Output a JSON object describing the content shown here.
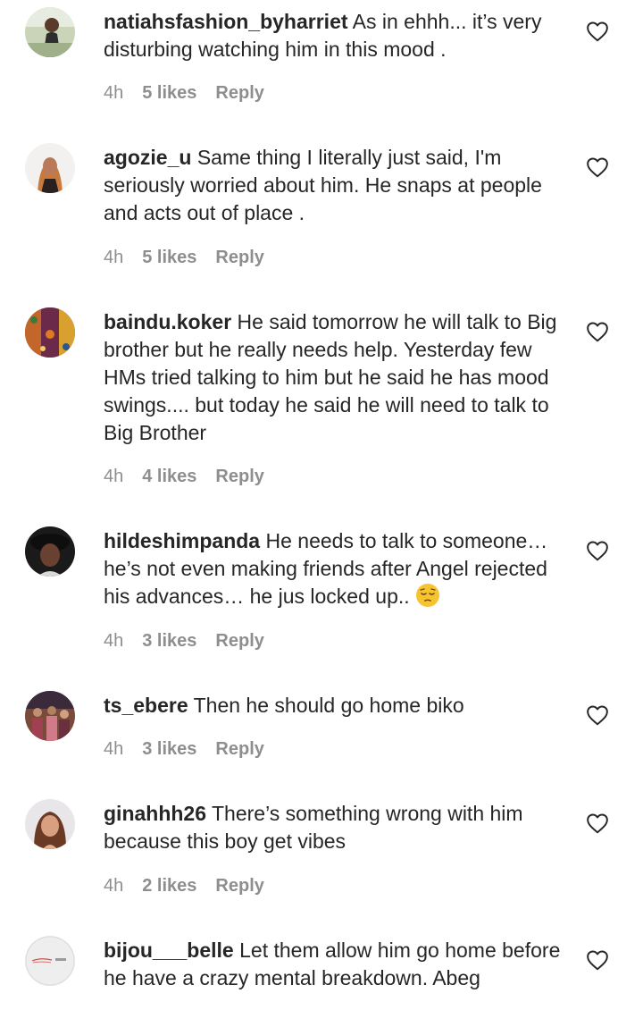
{
  "comments": [
    {
      "username": "natiahsfashion_byharriet",
      "text": "As in ehhh... it’s very disturbing watching him in this mood .",
      "time": "4h",
      "likes": "5 likes",
      "reply": "Reply",
      "avatar": "photo-portrait-outdoor"
    },
    {
      "username": "agozie_u",
      "text": "Same thing I literally just said, I'm seriously worried about him. He snaps at people and acts out of place .",
      "time": "4h",
      "likes": "5 likes",
      "reply": "Reply",
      "avatar": "photo-portrait-woman"
    },
    {
      "username": "baindu.koker",
      "text": "He said tomorrow he will talk to Big brother but he really needs help. Yesterday few HMs tried talking to him but he said he has mood swings.... but today he said he will need to talk to Big Brother",
      "time": "4h",
      "likes": "4 likes",
      "reply": "Reply",
      "avatar": "photo-colorful-fabric"
    },
    {
      "username": "hildeshimpanda",
      "text": "He needs to talk to someone… he’s not even making friends after Angel rejected his advances… he jus locked up..",
      "time": "4h",
      "likes": "3 likes",
      "reply": "Reply",
      "avatar": "photo-portrait-dark",
      "emoji": "pensive-face"
    },
    {
      "username": "ts_ebere",
      "text": "Then he should go home biko",
      "time": "4h",
      "likes": "3 likes",
      "reply": "Reply",
      "avatar": "photo-group-stage"
    },
    {
      "username": "ginahhh26",
      "text": "There’s something wrong with him because this boy get vibes",
      "time": "4h",
      "likes": "2 likes",
      "reply": "Reply",
      "avatar": "photo-portrait-glam"
    },
    {
      "username": "bijou___belle",
      "text": "Let them allow him go home before he have a crazy mental breakdown. Abeg",
      "time": "",
      "likes": "",
      "reply": "",
      "avatar": "logo-light-gray"
    }
  ],
  "icons": {
    "like": "heart-outline-icon"
  },
  "colors": {
    "text": "#262626",
    "meta": "#8e8e8e",
    "background": "#ffffff"
  }
}
